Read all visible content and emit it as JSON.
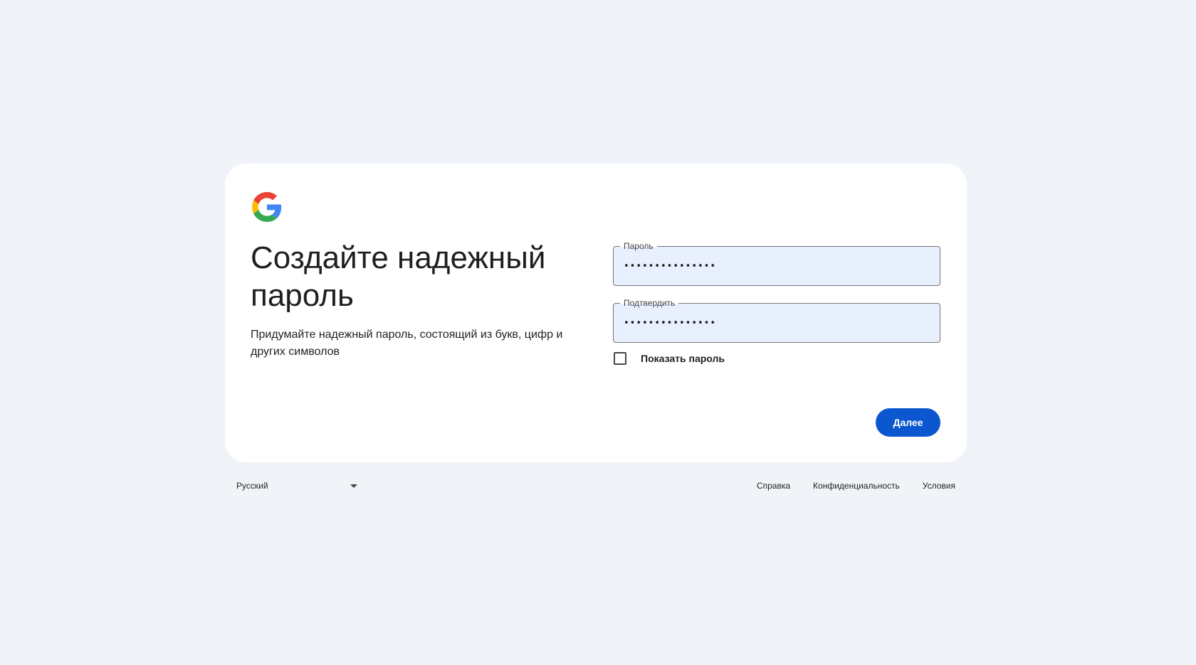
{
  "brand": {
    "logo_icon": "google-g-icon",
    "colors": {
      "blue": "#4285F4",
      "red": "#EA4335",
      "yellow": "#FBBC05",
      "green": "#34A853"
    }
  },
  "page": {
    "title": "Создайте надежный пароль",
    "subtitle": "Придумайте надежный пароль, состоящий из букв, цифр и других символов"
  },
  "form": {
    "password": {
      "label": "Пароль",
      "value": "•••••••••••••••"
    },
    "confirm": {
      "label": "Подтвердить",
      "value": "•••••••••••••••"
    },
    "show_password": {
      "label": "Показать пароль",
      "checked": false
    },
    "next_label": "Далее"
  },
  "footer": {
    "language": "Русский",
    "links": {
      "help": "Справка",
      "privacy": "Конфиденциальность",
      "terms": "Условия"
    }
  },
  "colors": {
    "background": "#f0f4f9",
    "card": "#ffffff",
    "primary_button": "#0b57d0",
    "autofill_field": "#e8f0fe"
  }
}
